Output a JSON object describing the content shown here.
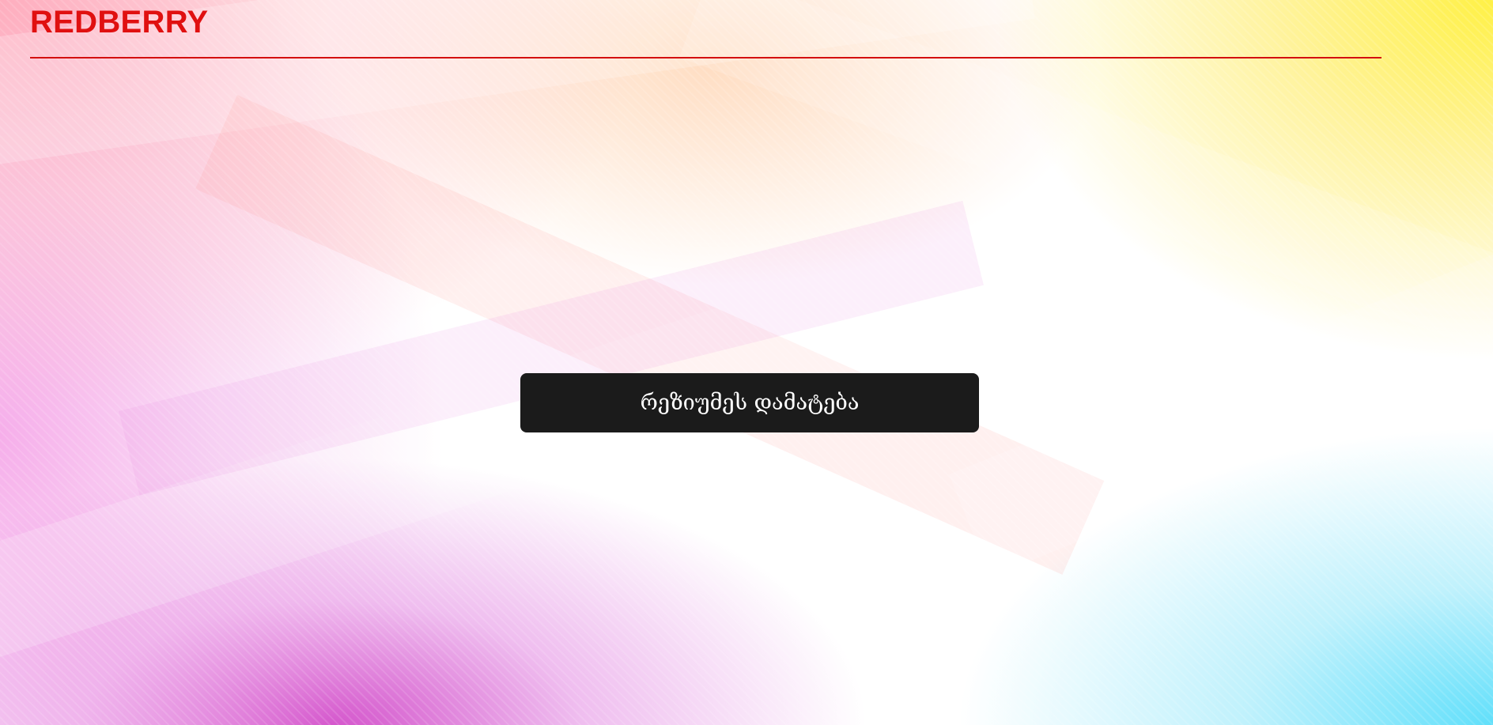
{
  "header": {
    "logo_text": "REDBERRY",
    "accent_color": "#e01010"
  },
  "main": {
    "add_resume_label": "რეზიუმეს დამატება",
    "button_color": "#1b1b1b"
  }
}
